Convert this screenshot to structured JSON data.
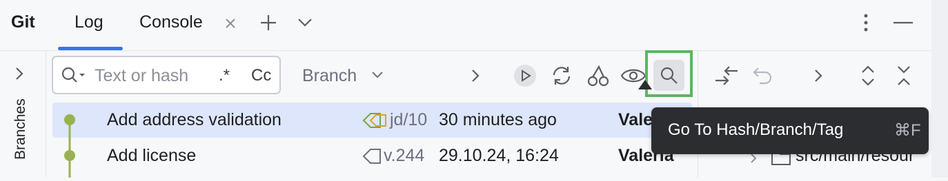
{
  "toolwindow": {
    "title": "Git",
    "tabs": [
      {
        "label": "Log",
        "active": true
      },
      {
        "label": "Console",
        "closable": true
      }
    ],
    "icons": [
      "plus-icon",
      "chevron-down-icon",
      "more-vertical-icon",
      "minimize-icon"
    ]
  },
  "sidebar": {
    "label": "Branches"
  },
  "filter": {
    "search_placeholder": "Text or hash",
    "regex_label": ".*",
    "case_label": "Cc",
    "branch_label": "Branch"
  },
  "commits": [
    {
      "message": "Add address validation",
      "ref": "jd/10",
      "date": "30 minutes ago",
      "author": "Vale",
      "selected": true
    },
    {
      "message": "Add license",
      "ref": "v.244",
      "date": "29.10.24, 16:24",
      "author": "Valeria",
      "selected": false
    }
  ],
  "details": {
    "path_fragment": "src/main/resour"
  },
  "tooltip": {
    "text": "Go To Hash/Branch/Tag",
    "shortcut": "⌘F"
  },
  "colors": {
    "accent": "#3574f0",
    "selection": "#dde6fb",
    "highlight": "#5fb55f",
    "graph": "#9ab14f",
    "tooltip_bg": "#2b2d30"
  }
}
